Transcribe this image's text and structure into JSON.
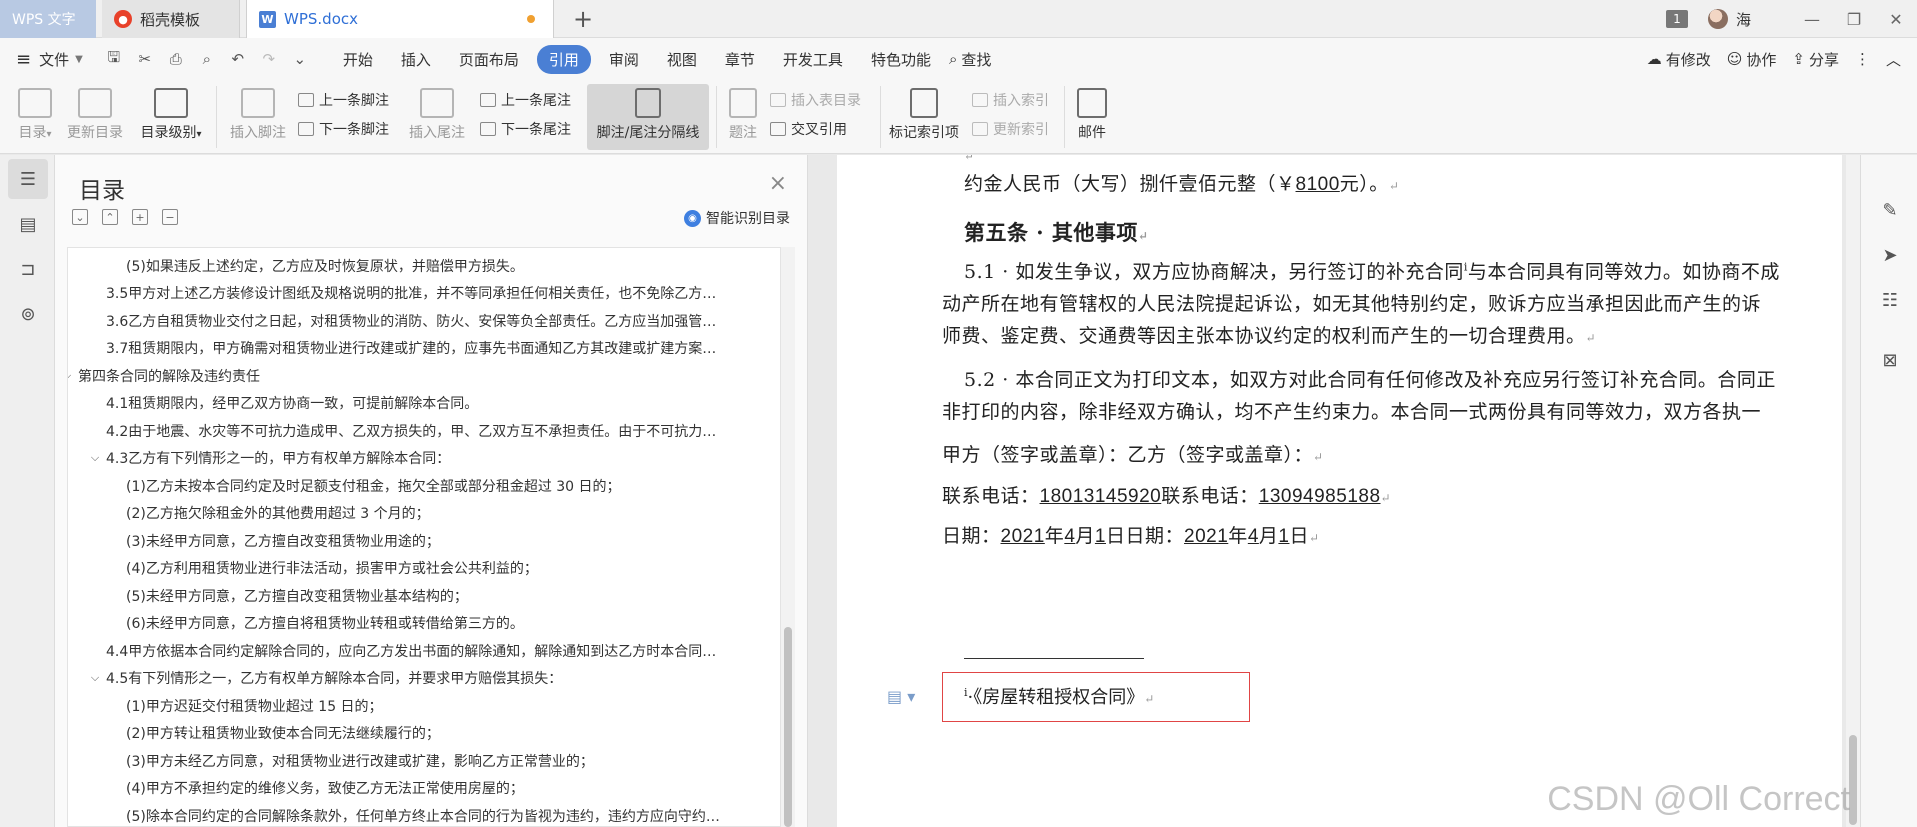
{
  "app_tab": "WPS 文字",
  "tabs": [
    {
      "label": "稻壳模板",
      "icon": "daoke-icon"
    },
    {
      "label": "WPS.docx",
      "icon": "wps-doc-icon"
    }
  ],
  "titlebar": {
    "window_count": "1",
    "user": "海"
  },
  "menu": {
    "file": "文件",
    "tabs": [
      "开始",
      "插入",
      "页面布局",
      "引用",
      "审阅",
      "视图",
      "章节",
      "开发工具",
      "特色功能"
    ],
    "active_tab": "引用",
    "search": "查找",
    "right": {
      "changes": "有修改",
      "collab": "协作",
      "share": "分享"
    }
  },
  "ribbon": {
    "toc": "目录",
    "update_toc": "更新目录",
    "toc_level": "目录级别",
    "insert_footnote": "插入脚注",
    "prev_footnote": "上一条脚注",
    "next_footnote": "下一条脚注",
    "insert_endnote": "插入尾注",
    "prev_endnote": "上一条尾注",
    "next_endnote": "下一条尾注",
    "separator_line": "脚注/尾注分隔线",
    "caption": "题注",
    "insert_table_toc": "插入表目录",
    "cross_ref": "交叉引用",
    "mark_index": "标记索引项",
    "insert_index": "插入索引",
    "update_index": "更新索引",
    "mail": "邮件"
  },
  "toc_panel": {
    "title": "目录",
    "smart": "智能识别目录",
    "items": [
      {
        "text": "(5)如果违反上述约定，乙方应及时恢复原状，并赔偿甲方损失。",
        "level": 3,
        "chev": ""
      },
      {
        "text": "3.5甲方对上述乙方装修设计图纸及规格说明的批准，并不等同承担任何相关责任，也不免除乙方…",
        "level": 2,
        "chev": ""
      },
      {
        "text": "3.6乙方自租赁物业交付之日起，对租赁物业的消防、防火、安保等负全部责任。乙方应当加强管…",
        "level": 2,
        "chev": ""
      },
      {
        "text": "3.7租赁期限内，甲方确需对租赁物业进行改建或扩建的，应事先书面通知乙方其改建或扩建方案…",
        "level": 2,
        "chev": ""
      },
      {
        "text": "第四条合同的解除及违约责任",
        "level": 1,
        "chev": "⌵"
      },
      {
        "text": "4.1租赁期限内，经甲乙双方协商一致，可提前解除本合同。",
        "level": 2,
        "chev": ""
      },
      {
        "text": "4.2由于地震、水灾等不可抗力造成甲、乙双方损失的，甲、乙双方互不承担责任。由于不可抗力…",
        "level": 2,
        "chev": ""
      },
      {
        "text": "4.3乙方有下列情形之一的，甲方有权单方解除本合同：",
        "level": 2,
        "chev": "⌵"
      },
      {
        "text": "(1)乙方未按本合同约定及时足额支付租金，拖欠全部或部分租金超过 30 日的；",
        "level": 3,
        "chev": ""
      },
      {
        "text": "(2)乙方拖欠除租金外的其他费用超过 3 个月的；",
        "level": 3,
        "chev": ""
      },
      {
        "text": "(3)未经甲方同意，乙方擅自改变租赁物业用途的；",
        "level": 3,
        "chev": ""
      },
      {
        "text": "(4)乙方利用租赁物业进行非法活动，损害甲方或社会公共利益的；",
        "level": 3,
        "chev": ""
      },
      {
        "text": "(5)未经甲方同意，乙方擅自改变租赁物业基本结构的；",
        "level": 3,
        "chev": ""
      },
      {
        "text": "(6)未经甲方同意，乙方擅自将租赁物业转租或转借给第三方的。",
        "level": 3,
        "chev": ""
      },
      {
        "text": "4.4甲方依据本合同约定解除合同的，应向乙方发出书面的解除通知，解除通知到达乙方时本合同…",
        "level": 2,
        "chev": ""
      },
      {
        "text": "4.5有下列情形之一，乙方有权单方解除本合同，并要求甲方赔偿其损失：",
        "level": 2,
        "chev": "⌵"
      },
      {
        "text": "(1)甲方迟延交付租赁物业超过 15 日的；",
        "level": 3,
        "chev": ""
      },
      {
        "text": "(2)甲方转让租赁物业致使本合同无法继续履行的；",
        "level": 3,
        "chev": ""
      },
      {
        "text": "(3)甲方未经乙方同意，对租赁物业进行改建或扩建，影响乙方正常营业的；",
        "level": 3,
        "chev": ""
      },
      {
        "text": "(4)甲方不承担约定的维修义务，致使乙方无法正常使用房屋的；",
        "level": 3,
        "chev": ""
      },
      {
        "text": "(5)除本合同约定的合同解除条款外，任何单方终止本合同的行为皆视为违约，违约方应向守约…",
        "level": 3,
        "chev": ""
      }
    ]
  },
  "document": {
    "line1_pre": "约金人民币（大写）捌仟壹佰元整（￥",
    "line1_amount": "8100",
    "line1_post": "元）。",
    "section_title": "第五条 · 其他事项",
    "p51_a": "5.1 ·  如发生争议，双方应协商解决，另行签订的补充合同",
    "p51_fn": "i",
    "p51_b": "与本合同具有同等效力。如协商不成",
    "p51_line2": "动产所在地有管辖权的人民法院提起诉讼，如无其他特别约定，败诉方应当承担因此而产生的诉",
    "p51_line3": "师费、鉴定费、交通费等因主张本协议约定的权利而产生的一切合理费用。",
    "p52_line1": "5.2 ·  本合同正文为打印文本，如双方对此合同有任何修改及补充应另行签订补充合同。合同正",
    "p52_line2": "非打印的内容，除非经双方确认，均不产生约束力。本合同一式两份具有同等效力，双方各执一",
    "sign": "甲方（签字或盖章）：乙方（签字或盖章）：",
    "phone_label1": "联系电话：",
    "phone1": "18013145920",
    "phone_label2": "联系电话：",
    "phone2": "13094985188",
    "date_label1": "日期：",
    "date_label2": "日期：",
    "year1": "2021",
    "month1": "4",
    "day1": "1",
    "year2": "2021",
    "month2": "4",
    "day2": "1",
    "unit_year": "年",
    "unit_month": "月",
    "unit_day": "日",
    "footnote_mark": "i",
    "footnote_text": "·《房屋转租授权合同》"
  },
  "watermark": "CSDN @Oll Correct"
}
